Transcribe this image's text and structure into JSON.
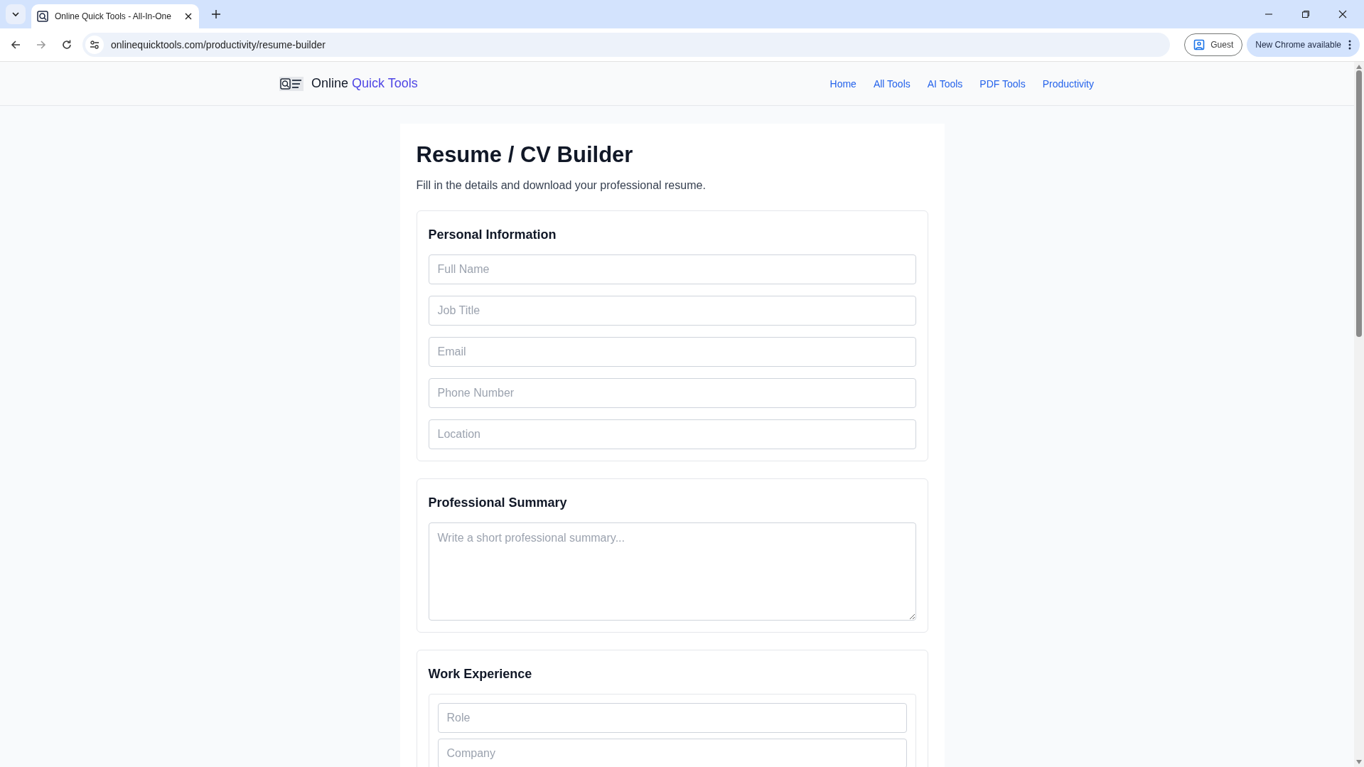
{
  "browser": {
    "tab_title": "Online Quick Tools - All-In-One",
    "url": "onlinequicktools.com/productivity/resume-builder",
    "profile": "Guest",
    "update_chip": "New Chrome available"
  },
  "site": {
    "brand": [
      {
        "text": "Online",
        "accent": false
      },
      {
        "text": "Quick Tools",
        "accent": true
      }
    ],
    "nav": [
      "Home",
      "All Tools",
      "AI Tools",
      "PDF Tools",
      "Productivity"
    ]
  },
  "page": {
    "title": "Resume / CV Builder",
    "subtitle": "Fill in the details and download your professional resume."
  },
  "sections": [
    {
      "title": "Personal Information",
      "kind": "fields",
      "fields": [
        {
          "placeholder": "Full Name"
        },
        {
          "placeholder": "Job Title"
        },
        {
          "placeholder": "Email"
        },
        {
          "placeholder": "Phone Number"
        },
        {
          "placeholder": "Location"
        }
      ]
    },
    {
      "title": "Professional Summary",
      "kind": "textarea",
      "placeholder": "Write a short professional summary..."
    },
    {
      "title": "Work Experience",
      "kind": "group",
      "fields": [
        {
          "placeholder": "Role"
        },
        {
          "placeholder": "Company"
        }
      ]
    }
  ]
}
